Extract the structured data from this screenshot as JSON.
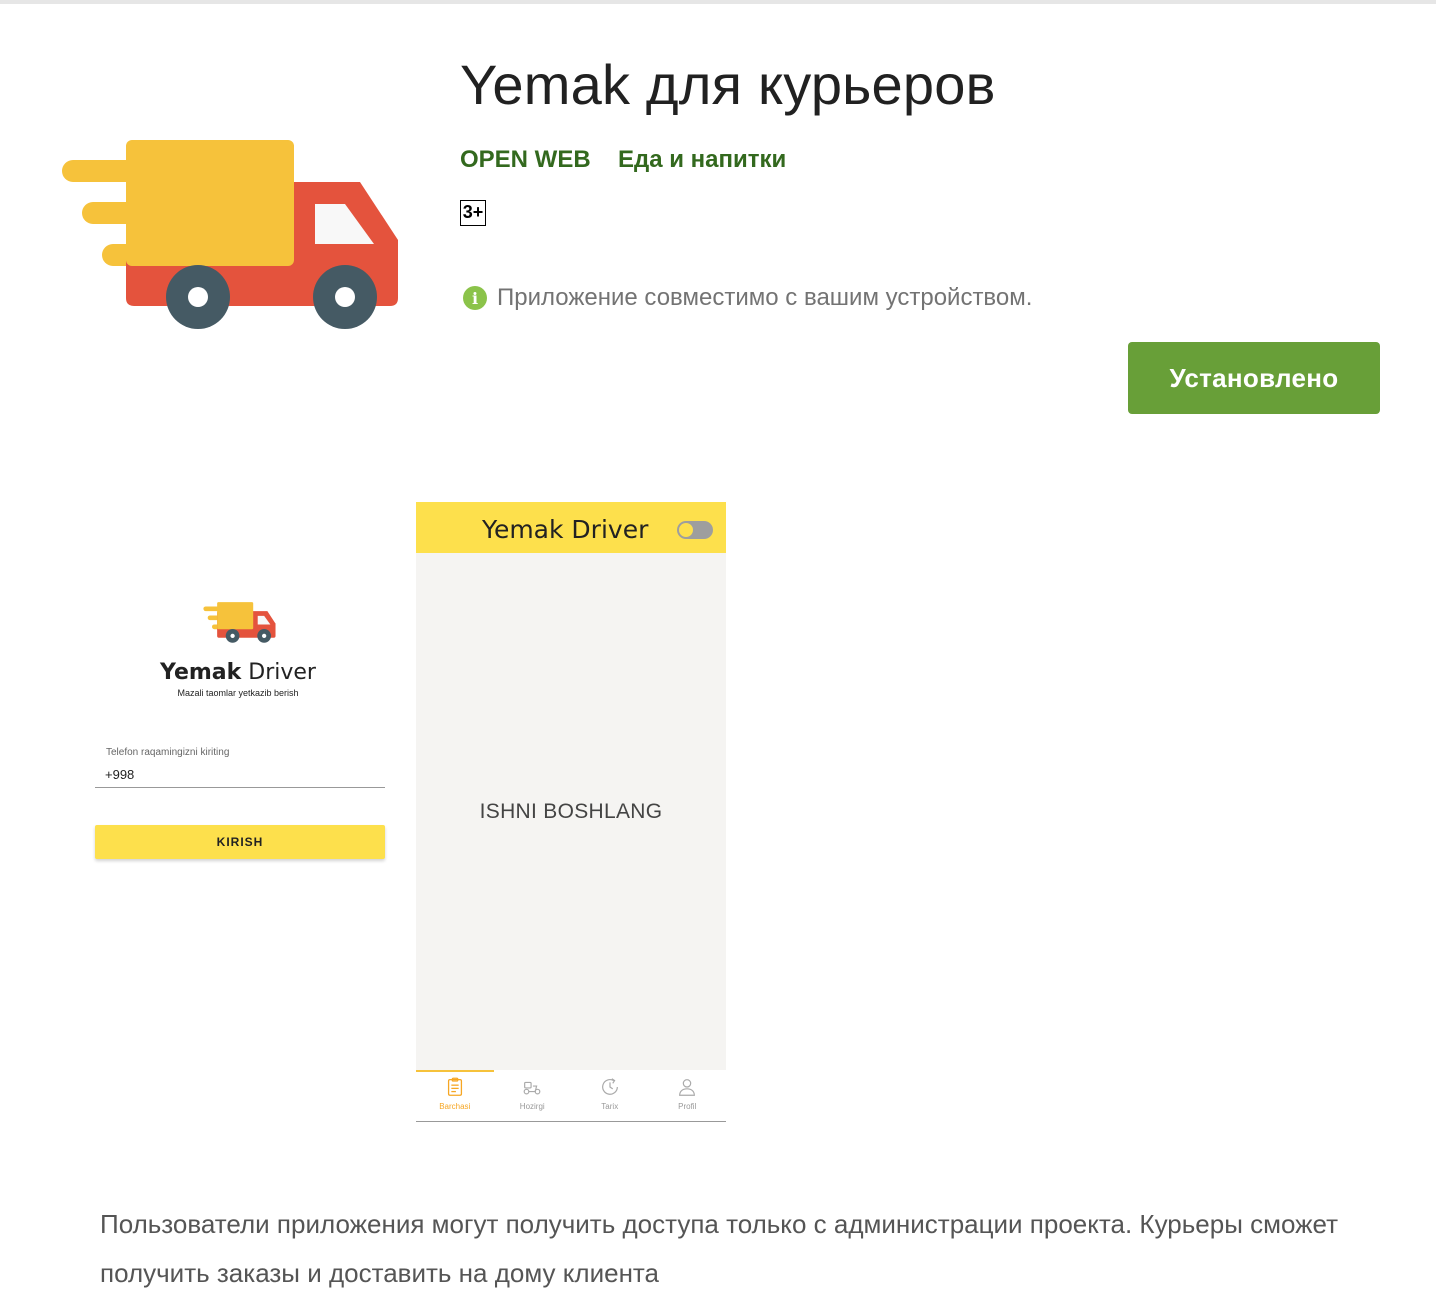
{
  "app": {
    "title": "Yemak для курьеров",
    "developer": "OPEN WEB",
    "category": "Еда и напитки",
    "rating": "3+",
    "compatibility": "Приложение совместимо с вашим устройством.",
    "install_label": "Установлено",
    "icon": "delivery-truck-icon"
  },
  "screenshots": {
    "login": {
      "brand_light": "Yemak",
      "brand_bold": " Driver",
      "tagline": "Mazali taomlar yetkazib berish",
      "phone_label": "Telefon raqamingizni kiriting",
      "phone_value": "+998",
      "login_label": "KIRISH"
    },
    "home": {
      "title": "Yemak Driver",
      "start_text": "ISHNI BOSHLANG",
      "nav": [
        {
          "label": "Barchasi",
          "icon": "clipboard-list-icon",
          "active": true
        },
        {
          "label": "Hozirgi",
          "icon": "scooter-icon",
          "active": false
        },
        {
          "label": "Tarix",
          "icon": "history-icon",
          "active": false
        },
        {
          "label": "Profil",
          "icon": "user-icon",
          "active": false
        }
      ]
    }
  },
  "description": "Пользователи приложения могут получить доступа только с администрации проекта. Курьеры сможет получить заказы и доставить на дому клиента",
  "colors": {
    "brand_green": "#689f38",
    "link_green": "#33691e",
    "accent_yellow": "#fde04c",
    "truck_red": "#e4533d",
    "truck_cargo": "#f6c23b"
  }
}
